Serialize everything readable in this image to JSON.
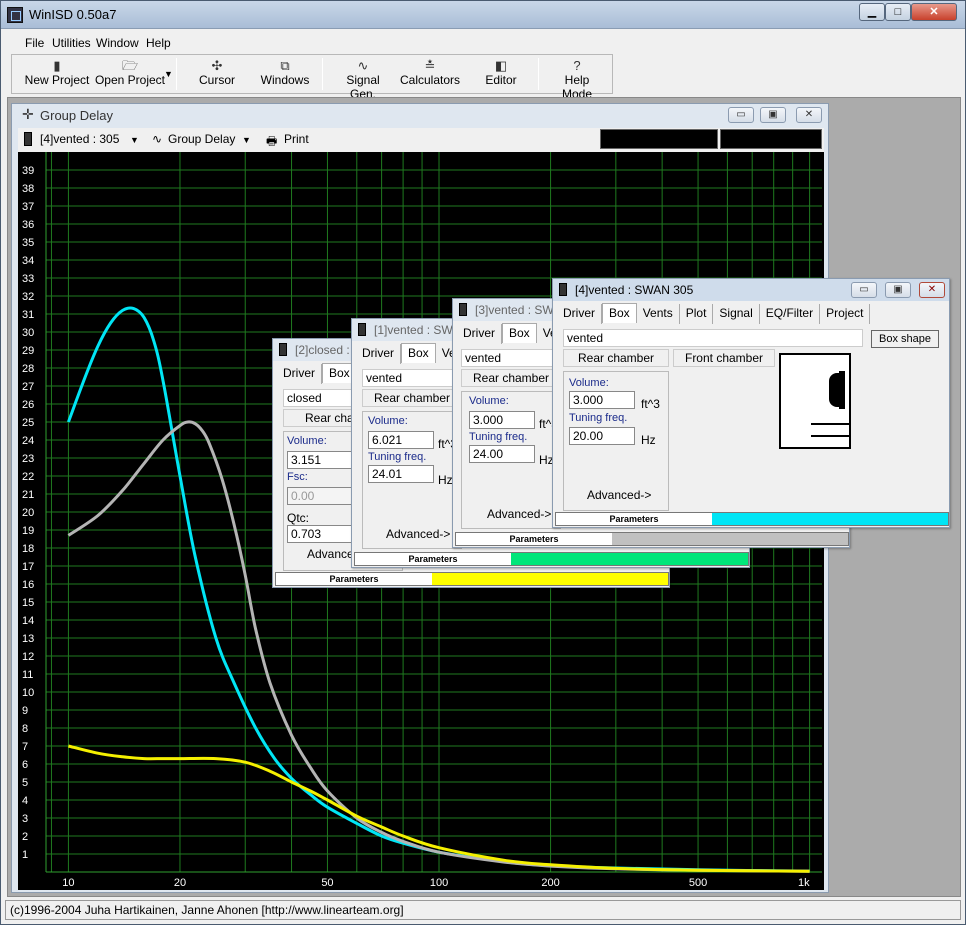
{
  "app": {
    "title": "WinISD 0.50a7",
    "status": "(c)1996-2004 Juha Hartikainen, Janne Ahonen [http://www.linearteam.org]"
  },
  "menu": [
    "File",
    "Utilities",
    "Window",
    "Help"
  ],
  "toolbar": {
    "new_project": "New Project",
    "open_project": "Open Project",
    "cursor": "Cursor",
    "windows": "Windows",
    "signal_gen": "Signal Gen.",
    "calculators": "Calculators",
    "editor": "Editor",
    "help_mode": "Help Mode"
  },
  "graph_window": {
    "title": "Group Delay",
    "project_select": "[4]vented : 305",
    "graph_select": "Group Delay",
    "print": "Print"
  },
  "chart_data": {
    "type": "line",
    "xscale": "log",
    "xlim": [
      8.7,
      1080
    ],
    "ylim": [
      0,
      40
    ],
    "grid": true,
    "x_ticks": [
      "10",
      "20",
      "50",
      "100",
      "200",
      "500",
      "1k"
    ],
    "x_tick_values": [
      10,
      20,
      50,
      100,
      200,
      500,
      1000
    ],
    "y_ticks": [
      "1",
      "2",
      "3",
      "4",
      "5",
      "6",
      "7",
      "8",
      "9",
      "10",
      "11",
      "12",
      "13",
      "14",
      "15",
      "16",
      "17",
      "18",
      "19",
      "20",
      "21",
      "22",
      "23",
      "24",
      "25",
      "26",
      "27",
      "28",
      "29",
      "30",
      "31",
      "32",
      "33",
      "34",
      "35",
      "36",
      "37",
      "38",
      "39"
    ],
    "series": [
      {
        "color": "#00e5f5",
        "x": [
          10,
          11,
          12,
          13,
          14,
          15,
          16,
          17,
          18,
          20,
          22,
          25,
          28,
          32,
          36,
          40,
          45,
          50,
          60,
          70,
          80,
          100,
          130,
          160,
          200,
          300,
          500,
          1000
        ],
        "y": [
          25,
          27.3,
          29.2,
          30.5,
          31.2,
          31.3,
          30.8,
          29.5,
          27.3,
          22,
          17.5,
          13,
          10.5,
          8,
          6.3,
          5.2,
          4.3,
          3.6,
          2.7,
          2,
          1.6,
          1.1,
          0.75,
          0.5,
          0.35,
          0.22,
          0.12,
          0.05
        ]
      },
      {
        "color": "#b4b4b4",
        "x": [
          10,
          12,
          14,
          16,
          18,
          20,
          21,
          22,
          23,
          24,
          26,
          28,
          30,
          32,
          35,
          40,
          45,
          50,
          60,
          70,
          80,
          100,
          150,
          200,
          300,
          500,
          1000
        ],
        "y": [
          18.7,
          19.8,
          21.2,
          22.7,
          24,
          24.8,
          25,
          24.9,
          24.5,
          23.8,
          21.8,
          19.3,
          16.5,
          13.5,
          10.5,
          7.6,
          5.8,
          4.5,
          3,
          2.2,
          1.7,
          1.1,
          0.55,
          0.33,
          0.18,
          0.1,
          0.04
        ]
      },
      {
        "color": "#f5f000",
        "x": [
          10,
          12,
          14,
          16,
          18,
          20,
          25,
          30,
          35,
          40,
          45,
          50,
          60,
          70,
          80,
          100,
          150,
          200,
          300,
          500,
          1000
        ],
        "y": [
          7,
          6.6,
          6.4,
          6.3,
          6.3,
          6.3,
          6.3,
          6.1,
          5.6,
          5,
          4.5,
          4,
          3.1,
          2.5,
          2,
          1.35,
          0.65,
          0.4,
          0.2,
          0.1,
          0.04
        ]
      }
    ]
  },
  "win2": {
    "title": "[2]closed : SWAN 305",
    "tabs": [
      "Driver",
      "Box"
    ],
    "box_type": "closed",
    "rear_chamber": "Rear chamber",
    "volume_label": "Volume:",
    "volume": "3.151",
    "fsc_label": "Fsc:",
    "fsc": "0.00",
    "qtc_label": "Qtc:",
    "qtc": "0.703",
    "advanced": "Advanced->",
    "parameters": "Parameters",
    "color": "#ffff00",
    "level": 1.0
  },
  "win1": {
    "title": "[1]vented : SWAN 305",
    "tabs": [
      "Driver",
      "Box",
      "Vents"
    ],
    "box_type": "vented",
    "rear_chamber": "Rear chamber",
    "volume_label": "Volume:",
    "volume": "6.021",
    "volume_unit": "ft^3",
    "tuning_label": "Tuning freq.",
    "tuning": "24.01",
    "tuning_unit": "Hz",
    "advanced": "Advanced->",
    "parameters": "Parameters",
    "color": "#00e67a",
    "level": 1.0
  },
  "win3": {
    "title": "[3]vented : SWAN 305",
    "tabs": [
      "Driver",
      "Box",
      "Vents"
    ],
    "box_type": "vented",
    "rear_chamber": "Rear chamber",
    "volume_label": "Volume:",
    "volume": "3.000",
    "volume_unit": "ft^3",
    "tuning_label": "Tuning freq.",
    "tuning": "24.00",
    "tuning_unit": "Hz",
    "advanced": "Advanced->",
    "parameters": "Parameters",
    "color": "#c0c0c0",
    "level": 1.0
  },
  "win4": {
    "title": "[4]vented : SWAN 305",
    "tabs": [
      "Driver",
      "Box",
      "Vents",
      "Plot",
      "Signal",
      "EQ/Filter",
      "Project"
    ],
    "box_type": "vented",
    "box_shape": "Box shape",
    "rear_chamber": "Rear chamber",
    "front_chamber": "Front chamber",
    "volume_label": "Volume:",
    "volume": "3.000",
    "volume_unit": "ft^3",
    "tuning_label": "Tuning freq.",
    "tuning": "20.00",
    "tuning_unit": "Hz",
    "advanced": "Advanced->",
    "parameters": "Parameters",
    "color": "#00e5f5",
    "level": 1.0
  }
}
